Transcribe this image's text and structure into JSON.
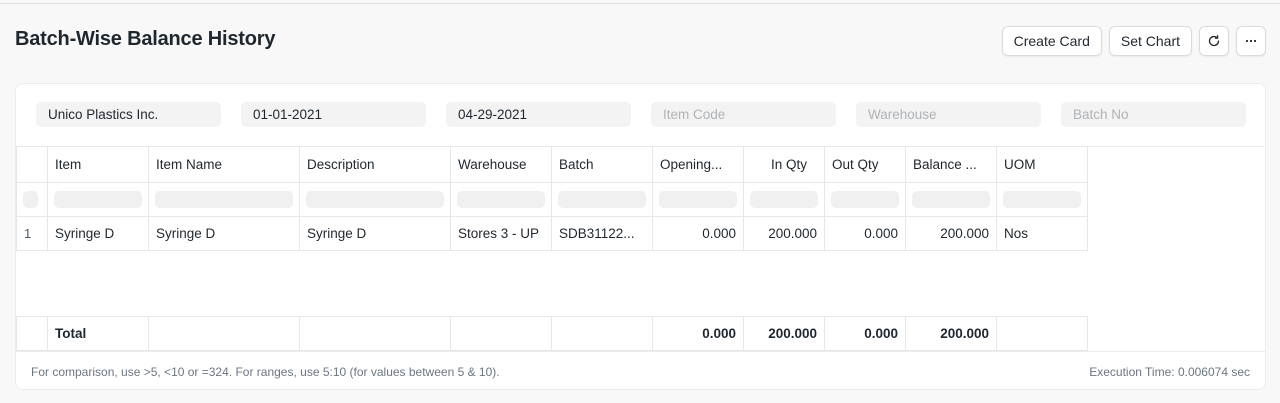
{
  "page": {
    "title": "Batch-Wise Balance History"
  },
  "actions": {
    "create_card": "Create Card",
    "set_chart": "Set Chart",
    "refresh_icon": "refresh-icon",
    "more_icon": "more-icon"
  },
  "filters": {
    "company": "Unico Plastics Inc.",
    "from_date": "01-01-2021",
    "to_date": "04-29-2021",
    "item_code_placeholder": "Item Code",
    "warehouse_placeholder": "Warehouse",
    "batch_no_placeholder": "Batch No"
  },
  "table": {
    "columns": [
      "Item",
      "Item Name",
      "Description",
      "Warehouse",
      "Batch",
      "Opening...",
      "In Qty",
      "Out Qty",
      "Balance ...",
      "UOM"
    ],
    "rows": [
      {
        "index": "1",
        "item": "Syringe D",
        "item_name": "Syringe D",
        "description": "Syringe D",
        "warehouse": "Stores 3 - UP",
        "batch": "SDB31122...",
        "opening": "0.000",
        "in_qty": "200.000",
        "out_qty": "0.000",
        "balance": "200.000",
        "uom": "Nos"
      }
    ],
    "total": {
      "label": "Total",
      "opening": "0.000",
      "in_qty": "200.000",
      "out_qty": "0.000",
      "balance": "200.000"
    }
  },
  "footer": {
    "hint": "For comparison, use >5, <10 or =324. For ranges, use 5:10 (for values between 5 & 10).",
    "execution_time": "Execution Time: 0.006074 sec"
  }
}
